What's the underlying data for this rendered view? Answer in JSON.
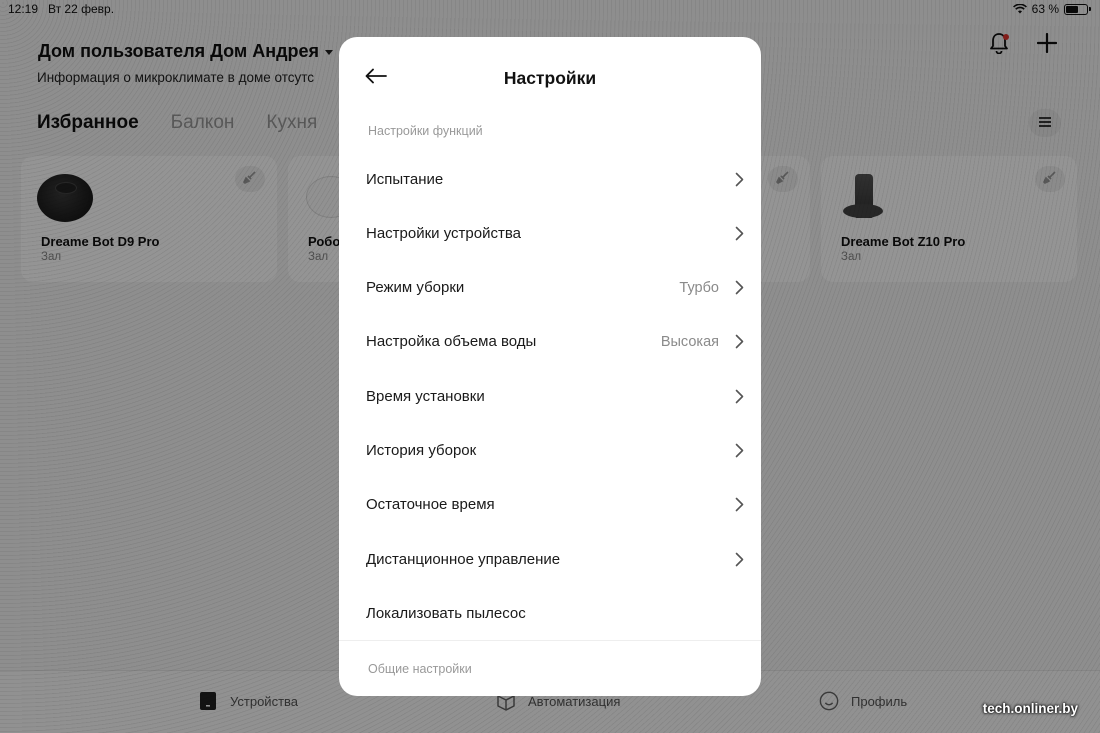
{
  "status_bar": {
    "time": "12:19",
    "date": "Вт 22 февр.",
    "battery_text": "63 %",
    "battery_level": 0.63
  },
  "home": {
    "title": "Дом пользователя Дом Андрея",
    "subtitle": "Информация о микроклимате в доме отсутс"
  },
  "tabs": [
    "Избранное",
    "Балкон",
    "Кухня"
  ],
  "devices": [
    {
      "name": "Dreame Bot D9 Pro",
      "room": "Зал"
    },
    {
      "name": "Робо",
      "room": "Зал"
    },
    {
      "name": "Dreame Bot Z10 Pro",
      "room": "Зал"
    }
  ],
  "bottom_nav": {
    "devices": "Устройства",
    "automation": "Автоматизация",
    "profile": "Профиль"
  },
  "watermark": "tech.onliner.by",
  "modal": {
    "title": "Настройки",
    "section_functions": "Настройки функций",
    "section_general": "Общие настройки",
    "rows": [
      {
        "label": "Испытание",
        "value": "",
        "chevron": true
      },
      {
        "label": "Настройки устройства",
        "value": "",
        "chevron": true
      },
      {
        "label": "Режим уборки",
        "value": "Турбо",
        "chevron": true
      },
      {
        "label": "Настройка объема воды",
        "value": "Высокая",
        "chevron": true
      },
      {
        "label": "Время установки",
        "value": "",
        "chevron": true
      },
      {
        "label": "История уборок",
        "value": "",
        "chevron": true
      },
      {
        "label": "Остаточное время",
        "value": "",
        "chevron": true
      },
      {
        "label": "Дистанционное управление",
        "value": "",
        "chevron": true
      },
      {
        "label": "Локализовать пылесос",
        "value": "",
        "chevron": false
      }
    ]
  },
  "colors": {
    "accent_dot": "#e3342f",
    "overlay": "#000000"
  }
}
